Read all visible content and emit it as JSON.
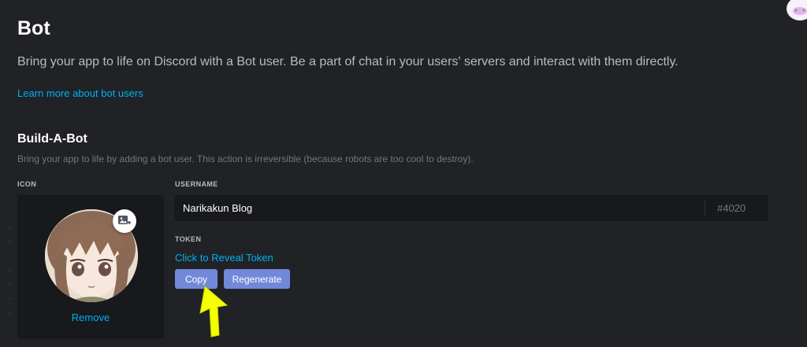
{
  "header": {
    "title": "Bot",
    "description": "Bring your app to life on Discord with a Bot user. Be a part of chat in your users' servers and interact with them directly.",
    "learn_more_link": "Learn more about bot users"
  },
  "build_a_bot": {
    "title": "Build-A-Bot",
    "subtitle": "Bring your app to life by adding a bot user. This action is irreversible (because robots are too cool to destroy).",
    "icon_label": "ICON",
    "remove_label": "Remove",
    "username_label": "USERNAME",
    "username_value": "Narikakun Blog",
    "discriminator": "#4020",
    "token_label": "TOKEN",
    "reveal_token_link": "Click to Reveal Token",
    "copy_button": "Copy",
    "regenerate_button": "Regenerate"
  },
  "icons": {
    "upload": "image-upload-icon",
    "avatar": "bot-avatar-anime-girl",
    "arrow": "yellow-pointer-arrow-annotation"
  },
  "colors": {
    "background": "#202225",
    "link": "#00b0f4",
    "button": "#7289da",
    "annotation_arrow": "#f5ff00"
  }
}
